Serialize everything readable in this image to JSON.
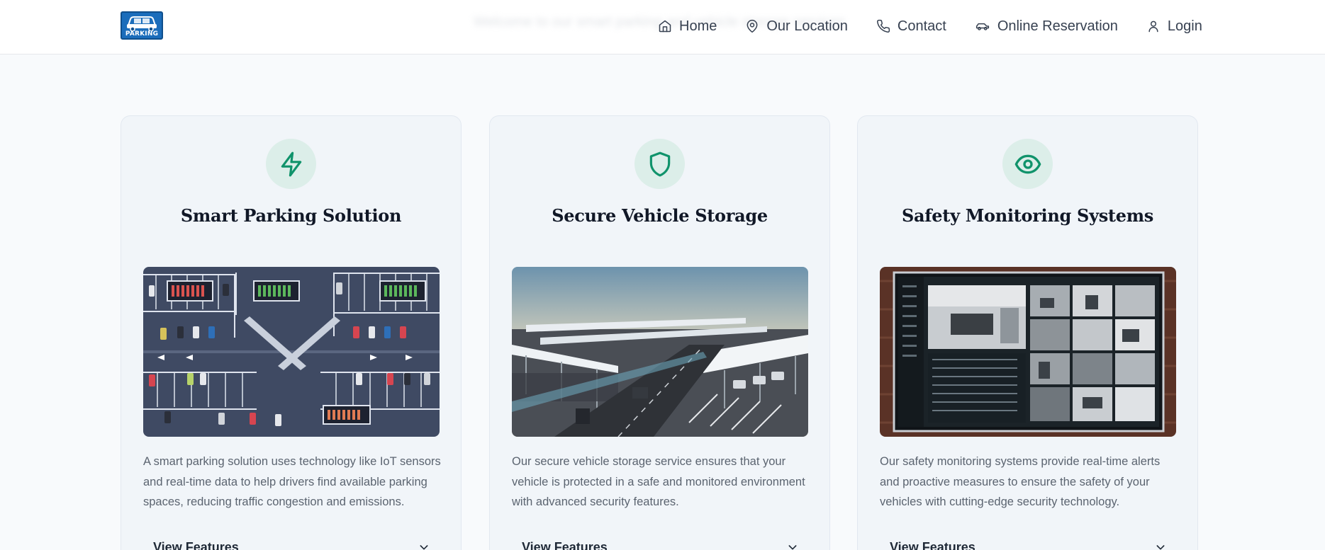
{
  "header": {
    "logo_text": "PARKING",
    "background_tagline": "Welcome to our smart parking and vehicle storage services"
  },
  "nav": {
    "items": [
      {
        "label": "Home",
        "icon": "home-icon"
      },
      {
        "label": "Our Location",
        "icon": "map-pin-icon"
      },
      {
        "label": "Contact",
        "icon": "phone-icon"
      },
      {
        "label": "Online Reservation",
        "icon": "car-icon"
      },
      {
        "label": "Login",
        "icon": "user-icon"
      }
    ]
  },
  "colors": {
    "accent": "#10936b",
    "icon_bg": "#dceee9",
    "logo_blue": "#1b6dbb"
  },
  "cards": [
    {
      "icon": "lightning-icon",
      "title": "Smart Parking Solution",
      "image": "aerial-smart-parking-lot",
      "description": "A smart parking solution uses technology like IoT sensors and real-time data to help drivers find available parking spaces, reducing traffic congestion and emissions.",
      "toggle_label": "View Features"
    },
    {
      "icon": "shield-icon",
      "title": "Secure Vehicle Storage",
      "image": "covered-secure-parking-facility",
      "description": "Our secure vehicle storage service ensures that your vehicle is protected in a safe and monitored environment with advanced security features.",
      "toggle_label": "View Features"
    },
    {
      "icon": "eye-icon",
      "title": "Safety Monitoring Systems",
      "image": "cctv-monitoring-dashboard",
      "description": "Our safety monitoring systems provide real-time alerts and proactive measures to ensure the safety of your vehicles with cutting-edge security technology.",
      "toggle_label": "View Features"
    }
  ]
}
